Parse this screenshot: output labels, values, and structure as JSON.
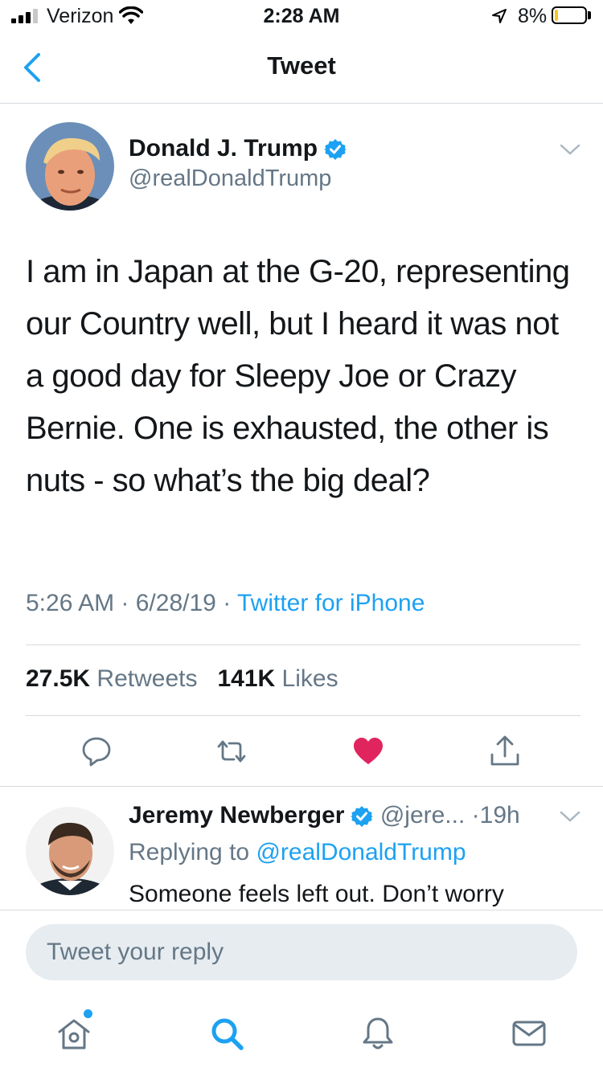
{
  "status_bar": {
    "carrier": "Verizon",
    "time": "2:28 AM",
    "battery_percent": "8%",
    "battery_level": 0.08
  },
  "nav": {
    "title": "Tweet",
    "back_icon": "chevron-left-icon"
  },
  "tweet": {
    "author_name": "Donald J. Trump",
    "handle": "@realDonaldTrump",
    "text": "I am in Japan at the G-20, representing our Country well, but I heard it was not a good day for Sleepy Joe or Crazy Bernie. One is exhausted, the other is nuts - so what’s the big deal?",
    "time": "5:26 AM",
    "date": "6/28/19",
    "source": "Twitter for iPhone",
    "retweet_count": "27.5K",
    "retweet_label": "Retweets",
    "like_count": "141K",
    "like_label": "Likes"
  },
  "reply": {
    "author_name": "Jeremy Newberger",
    "handle": "@jere...",
    "age": "19h",
    "replying_prefix": "Replying to",
    "replying_to": "@realDonaldTrump",
    "text": "Someone feels left out. Don’t worry"
  },
  "composer": {
    "placeholder": "Tweet your reply"
  },
  "tab_bar": {
    "tabs": [
      "home-icon",
      "search-icon",
      "notifications-icon",
      "messages-icon"
    ]
  },
  "colors": {
    "accent": "#1da1f2",
    "like_red": "#e0245e",
    "muted": "#657786",
    "text": "#14171a"
  }
}
